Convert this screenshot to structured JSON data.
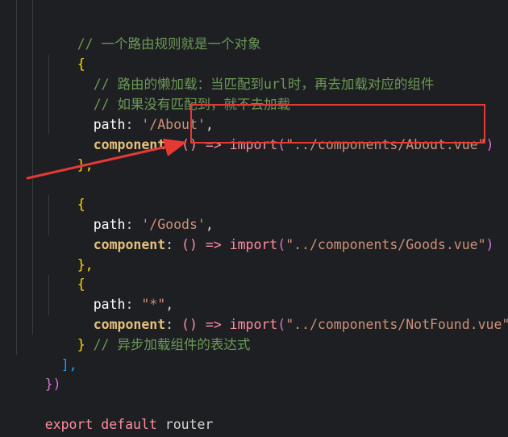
{
  "code": {
    "comment_rule_is_object": "// 一个路由规则就是一个对象",
    "open_brace": "{",
    "comment_lazy": "// 路由的懒加载：当匹配到url时，再去加载对应的组件",
    "comment_no_match": "// 如果没有匹配到，就不去加载",
    "path_key": "path",
    "colon": ":",
    "comma": ",",
    "about_path": "'/About'",
    "component_key": "component",
    "arrow_fn": "() =>",
    "import_kw": "import",
    "paren_open": "(",
    "paren_close": ")",
    "about_import": "\"../components/About.vue\"",
    "close_brace_comma": "},",
    "goods_path": "'/Goods'",
    "goods_import": "\"../components/Goods.vue\"",
    "star_path": "\"*\"",
    "notfound_import": "\"../components/NotFound.vue\"",
    "close_brace": "}",
    "comment_async": "// 异步加载组件的表达式",
    "close_bracket_comma": "],",
    "close_brace_paren": "})",
    "export_default": "export default",
    "router": "router"
  },
  "colors": {
    "background": "#1e1f22",
    "comment": "#6a9955",
    "string": "#ce9178",
    "keyword": "#ff8da1",
    "component": "#e5c07b",
    "annotation_red": "#e53935"
  }
}
